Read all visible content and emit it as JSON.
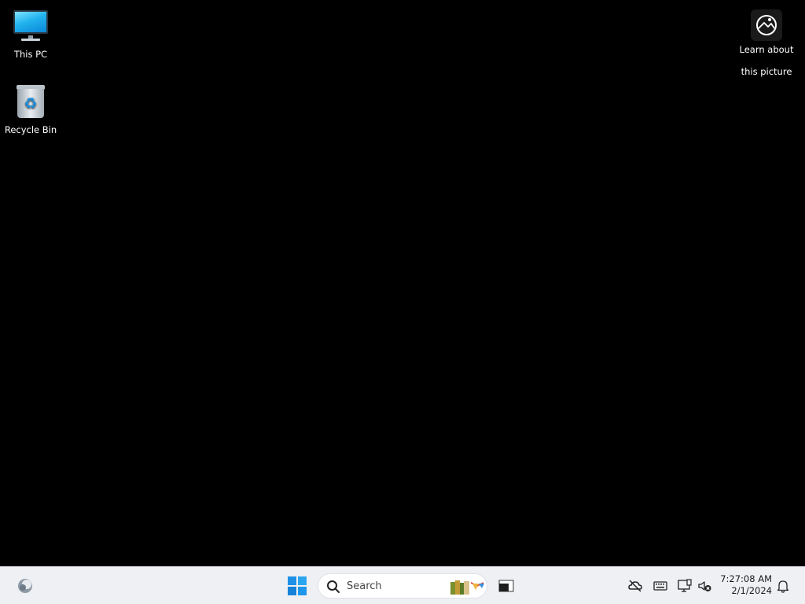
{
  "desktop": {
    "icons": [
      {
        "label": "This PC",
        "icon": "monitor-icon"
      },
      {
        "label": "Recycle Bin",
        "icon": "recycle-bin-icon"
      }
    ],
    "spotlight": {
      "label_line1": "Learn about",
      "label_line2": "this picture",
      "icon": "camera-aperture-icon"
    },
    "background_color": "#000000"
  },
  "taskbar": {
    "background_color": "#eef0f3",
    "widgets_icon": "widgets-icon",
    "start_icon": "windows-start-icon",
    "search": {
      "placeholder": "Search",
      "icon": "search-icon"
    },
    "apps": [
      {
        "icon": "terminal-app-icon"
      }
    ],
    "tray": [
      {
        "icon": "onedrive-offline-icon"
      },
      {
        "icon": "keyboard-icon"
      },
      {
        "icon": "network-icon"
      },
      {
        "icon": "volume-muted-icon"
      }
    ],
    "clock": {
      "time": "7:27:08 AM",
      "date": "2/1/2024"
    },
    "notifications_icon": "bell-icon"
  }
}
